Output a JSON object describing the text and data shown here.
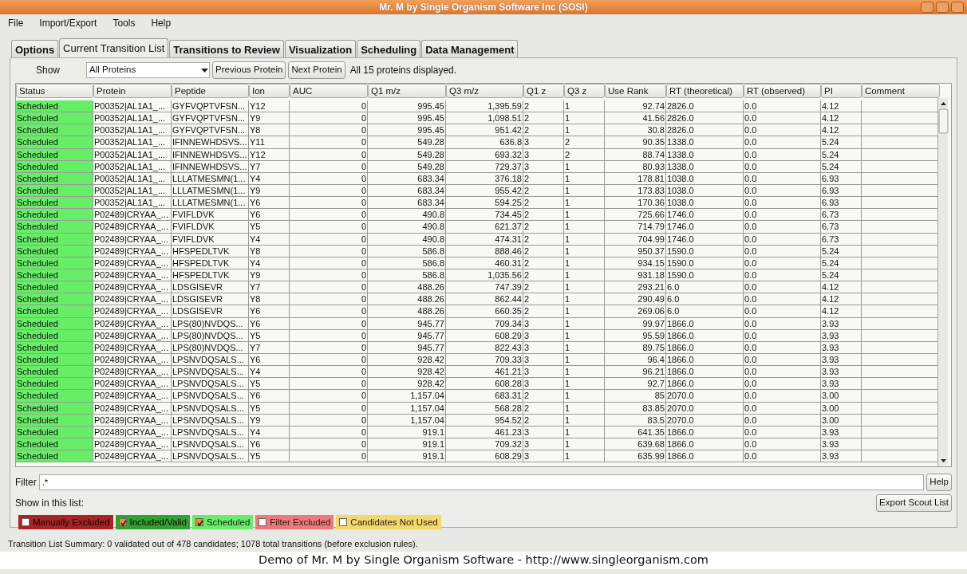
{
  "window": {
    "title": "Mr. M by Single Organism Software Inc (SOSI)"
  },
  "menu": [
    "File",
    "Import/Export",
    "Tools",
    "Help"
  ],
  "tabs": [
    {
      "label": "Options",
      "selected": false
    },
    {
      "label": "Current Transition List",
      "selected": true
    },
    {
      "label": "Transitions to Review",
      "selected": false
    },
    {
      "label": "Visualization",
      "selected": false
    },
    {
      "label": "Scheduling",
      "selected": false
    },
    {
      "label": "Data Management",
      "selected": false
    }
  ],
  "show": {
    "label": "Show",
    "value": "All Proteins",
    "buttons": [
      "Previous Protein",
      "Next Protein"
    ],
    "message": "All 15 proteins displayed."
  },
  "table": {
    "columns": [
      {
        "label": "Status",
        "kind": "status"
      },
      {
        "label": "Protein",
        "kind": "text"
      },
      {
        "label": "Peptide",
        "kind": "text"
      },
      {
        "label": "Ion",
        "kind": "text"
      },
      {
        "label": "AUC",
        "kind": "number"
      },
      {
        "label": "Q1 m/z",
        "kind": "number"
      },
      {
        "label": "Q3 m/z",
        "kind": "number"
      },
      {
        "label": "Q1 z",
        "kind": "text"
      },
      {
        "label": "Q3 z",
        "kind": "text"
      },
      {
        "label": "Use Rank",
        "kind": "number"
      },
      {
        "label": "RT (theoretical)",
        "kind": "text"
      },
      {
        "label": "RT (observed)",
        "kind": "text"
      },
      {
        "label": "PI",
        "kind": "text"
      },
      {
        "label": "Comment",
        "kind": "text"
      }
    ],
    "rows": [
      {
        "color": "#66ee66",
        "cells": [
          "Scheduled",
          "P00352|AL1A1_...",
          "GYFVQPTVFSN...",
          "Y12",
          "0",
          "995.45",
          "1,395.59",
          "2",
          "1",
          "92.74",
          "2826.0",
          "0.0",
          "4.12"
        ]
      },
      {
        "color": "#66ee66",
        "cells": [
          "Scheduled",
          "P00352|AL1A1_...",
          "GYFVQPTVFSN...",
          "Y9",
          "0",
          "995.45",
          "1,098.51",
          "2",
          "1",
          "41.56",
          "2826.0",
          "0.0",
          "4.12"
        ]
      },
      {
        "color": "#66ee66",
        "cells": [
          "Scheduled",
          "P00352|AL1A1_...",
          "GYFVQPTVFSN...",
          "Y8",
          "0",
          "995.45",
          "951.42",
          "2",
          "1",
          "30.8",
          "2826.0",
          "0.0",
          "4.12"
        ]
      },
      {
        "color": "#66ee66",
        "cells": [
          "Scheduled",
          "P00352|AL1A1_...",
          "IFINNEWHDSVS...",
          "Y11",
          "0",
          "549.28",
          "636.8",
          "3",
          "2",
          "90.35",
          "1338.0",
          "0.0",
          "5.24"
        ]
      },
      {
        "color": "#66ee66",
        "cells": [
          "Scheduled",
          "P00352|AL1A1_...",
          "IFINNEWHDSVS...",
          "Y12",
          "0",
          "549.28",
          "693.32",
          "3",
          "2",
          "88.74",
          "1338.0",
          "0.0",
          "5.24"
        ]
      },
      {
        "color": "#66ee66",
        "cells": [
          "Scheduled",
          "P00352|AL1A1_...",
          "IFINNEWHDSVS...",
          "Y7",
          "0",
          "549.28",
          "729.37",
          "3",
          "1",
          "80.93",
          "1338.0",
          "0.0",
          "5.24"
        ]
      },
      {
        "color": "#66ee66",
        "cells": [
          "Scheduled",
          "P00352|AL1A1_...",
          "LLLATMESMN(1...",
          "Y4",
          "0",
          "683.34",
          "376.18",
          "2",
          "1",
          "178.81",
          "1038.0",
          "0.0",
          "6.93"
        ]
      },
      {
        "color": "#66ee66",
        "cells": [
          "Scheduled",
          "P00352|AL1A1_...",
          "LLLATMESMN(1...",
          "Y9",
          "0",
          "683.34",
          "955.42",
          "2",
          "1",
          "173.83",
          "1038.0",
          "0.0",
          "6.93"
        ]
      },
      {
        "color": "#66ee66",
        "cells": [
          "Scheduled",
          "P00352|AL1A1_...",
          "LLLATMESMN(1...",
          "Y6",
          "0",
          "683.34",
          "594.25",
          "2",
          "1",
          "170.36",
          "1038.0",
          "0.0",
          "6.93"
        ]
      },
      {
        "color": "#66ee66",
        "cells": [
          "Scheduled",
          "P02489|CRYAA_...",
          "FVIFLDVK",
          "Y6",
          "0",
          "490.8",
          "734.45",
          "2",
          "1",
          "725.66",
          "1746.0",
          "0.0",
          "6.73"
        ]
      },
      {
        "color": "#66ee66",
        "cells": [
          "Scheduled",
          "P02489|CRYAA_...",
          "FVIFLDVK",
          "Y5",
          "0",
          "490.8",
          "621.37",
          "2",
          "1",
          "714.79",
          "1746.0",
          "0.0",
          "6.73"
        ]
      },
      {
        "color": "#66ee66",
        "cells": [
          "Scheduled",
          "P02489|CRYAA_...",
          "FVIFLDVK",
          "Y4",
          "0",
          "490.8",
          "474.31",
          "2",
          "1",
          "704.99",
          "1746.0",
          "0.0",
          "6.73"
        ]
      },
      {
        "color": "#66ee66",
        "cells": [
          "Scheduled",
          "P02489|CRYAA_...",
          "HFSPEDLTVK",
          "Y8",
          "0",
          "586.8",
          "888.46",
          "2",
          "1",
          "950.37",
          "1590.0",
          "0.0",
          "5.24"
        ]
      },
      {
        "color": "#66ee66",
        "cells": [
          "Scheduled",
          "P02489|CRYAA_...",
          "HFSPEDLTVK",
          "Y4",
          "0",
          "586.8",
          "460.31",
          "2",
          "1",
          "934.15",
          "1590.0",
          "0.0",
          "5.24"
        ]
      },
      {
        "color": "#66ee66",
        "cells": [
          "Scheduled",
          "P02489|CRYAA_...",
          "HFSPEDLTVK",
          "Y9",
          "0",
          "586.8",
          "1,035.56",
          "2",
          "1",
          "931.18",
          "1590.0",
          "0.0",
          "5.24"
        ]
      },
      {
        "color": "#66ee66",
        "cells": [
          "Scheduled",
          "P02489|CRYAA_...",
          "LDSGISEVR",
          "Y7",
          "0",
          "488.26",
          "747.39",
          "2",
          "1",
          "293.21",
          "6.0",
          "0.0",
          "4.12"
        ]
      },
      {
        "color": "#66ee66",
        "cells": [
          "Scheduled",
          "P02489|CRYAA_...",
          "LDSGISEVR",
          "Y8",
          "0",
          "488.26",
          "862.44",
          "2",
          "1",
          "290.49",
          "6.0",
          "0.0",
          "4.12"
        ]
      },
      {
        "color": "#66ee66",
        "cells": [
          "Scheduled",
          "P02489|CRYAA_...",
          "LDSGISEVR",
          "Y6",
          "0",
          "488.26",
          "660.35",
          "2",
          "1",
          "269.06",
          "6.0",
          "0.0",
          "4.12"
        ]
      },
      {
        "color": "#66ee66",
        "cells": [
          "Scheduled",
          "P02489|CRYAA_...",
          "LPS(80)NVDQS...",
          "Y6",
          "0",
          "945.77",
          "709.34",
          "3",
          "1",
          "99.97",
          "1866.0",
          "0.0",
          "3.93"
        ]
      },
      {
        "color": "#66ee66",
        "cells": [
          "Scheduled",
          "P02489|CRYAA_...",
          "LPS(80)NVDQS...",
          "Y5",
          "0",
          "945.77",
          "608.29",
          "3",
          "1",
          "95.59",
          "1866.0",
          "0.0",
          "3.93"
        ]
      },
      {
        "color": "#66ee66",
        "cells": [
          "Scheduled",
          "P02489|CRYAA_...",
          "LPS(80)NVDQS...",
          "Y7",
          "0",
          "945.77",
          "822.43",
          "3",
          "1",
          "89.75",
          "1866.0",
          "0.0",
          "3.93"
        ]
      },
      {
        "color": "#66ee66",
        "cells": [
          "Scheduled",
          "P02489|CRYAA_...",
          "LPSNVDQSALS...",
          "Y6",
          "0",
          "928.42",
          "709.33",
          "3",
          "1",
          "96.4",
          "1866.0",
          "0.0",
          "3.93"
        ]
      },
      {
        "color": "#66ee66",
        "cells": [
          "Scheduled",
          "P02489|CRYAA_...",
          "LPSNVDQSALS...",
          "Y4",
          "0",
          "928.42",
          "461.21",
          "3",
          "1",
          "96.21",
          "1866.0",
          "0.0",
          "3.93"
        ]
      },
      {
        "color": "#66ee66",
        "cells": [
          "Scheduled",
          "P02489|CRYAA_...",
          "LPSNVDQSALS...",
          "Y5",
          "0",
          "928.42",
          "608.28",
          "3",
          "1",
          "92.7",
          "1866.0",
          "0.0",
          "3.93"
        ]
      },
      {
        "color": "#66ee66",
        "cells": [
          "Scheduled",
          "P02489|CRYAA_...",
          "LPSNVDQSALS...",
          "Y6",
          "0",
          "1,157.04",
          "683.31",
          "2",
          "1",
          "85",
          "2070.0",
          "0.0",
          "3.00"
        ]
      },
      {
        "color": "#66ee66",
        "cells": [
          "Scheduled",
          "P02489|CRYAA_...",
          "LPSNVDQSALS...",
          "Y5",
          "0",
          "1,157.04",
          "568.28",
          "2",
          "1",
          "83.85",
          "2070.0",
          "0.0",
          "3.00"
        ]
      },
      {
        "color": "#66ee66",
        "cells": [
          "Scheduled",
          "P02489|CRYAA_...",
          "LPSNVDQSALS...",
          "Y9",
          "0",
          "1,157.04",
          "954.52",
          "2",
          "1",
          "83.5",
          "2070.0",
          "0.0",
          "3.00"
        ]
      },
      {
        "color": "#66ee66",
        "cells": [
          "Scheduled",
          "P02489|CRYAA_...",
          "LPSNVDQSALS...",
          "Y4",
          "0",
          "919.1",
          "461.23",
          "3",
          "1",
          "641.35",
          "1866.0",
          "0.0",
          "3.93"
        ]
      },
      {
        "color": "#66ee66",
        "cells": [
          "Scheduled",
          "P02489|CRYAA_...",
          "LPSNVDQSALS...",
          "Y6",
          "0",
          "919.1",
          "709.32",
          "3",
          "1",
          "639.68",
          "1866.0",
          "0.0",
          "3.93"
        ]
      },
      {
        "color": "#66ee66",
        "cells": [
          "Scheduled",
          "P02489|CRYAA_...",
          "LPSNVDQSALS...",
          "Y5",
          "0",
          "919.1",
          "608.29",
          "3",
          "1",
          "635.99",
          "1866.0",
          "0.0",
          "3.93"
        ]
      }
    ]
  },
  "filter": {
    "label": "Filter",
    "value": ".*",
    "help": "Help"
  },
  "legend": {
    "label": "Show in this list:",
    "export": "Export Scout List",
    "items": [
      {
        "label": "Manually Excluded",
        "checked": false,
        "color": "#a82424"
      },
      {
        "label": "Included/Valid",
        "checked": true,
        "color": "#2fa32f"
      },
      {
        "label": "Scheduled",
        "checked": true,
        "color": "#66ee66"
      },
      {
        "label": "Filter Excluded",
        "checked": false,
        "color": "#f07878"
      },
      {
        "label": "Candidates Not Used",
        "checked": false,
        "color": "#f5d86a"
      }
    ]
  },
  "status_bar": "Transition List Summary: 0 validated out of 478 candidates; 1078 total transitions (before exclusion rules).",
  "caption": "Demo of Mr. M by Single Organism Software - http://www.singleorganism.com"
}
